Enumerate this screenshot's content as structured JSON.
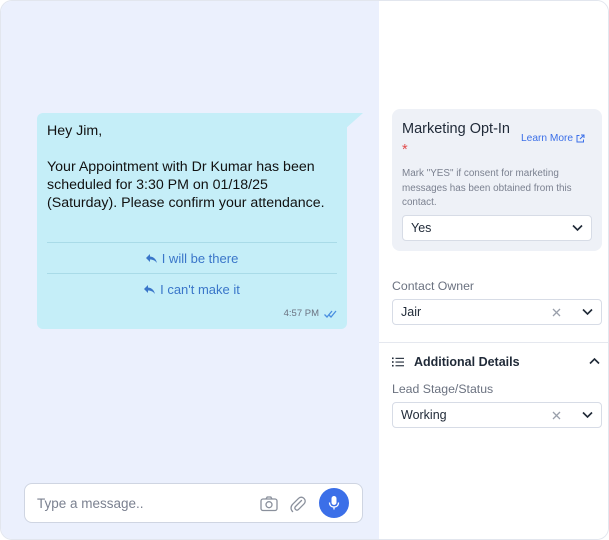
{
  "chat": {
    "message": {
      "text": "Hey Jim,\n\nYour Appointment with Dr Kumar has been scheduled for 3:30 PM on 01/18/25 (Saturday). Please confirm your attendance.",
      "quick_replies": [
        "I will be there",
        "I can't make it"
      ],
      "time": "4:57 PM"
    },
    "composer": {
      "placeholder": "Type a message.."
    }
  },
  "sidebar": {
    "marketing_optin": {
      "title": "Marketing Opt-In",
      "required_mark": "*",
      "learn_more": "Learn More",
      "description": "Mark \"YES\" if consent for marketing messages has been obtained from this contact.",
      "value": "Yes"
    },
    "contact_owner": {
      "label": "Contact Owner",
      "value": "Jair"
    },
    "additional_details": {
      "title": "Additional Details"
    },
    "lead_stage": {
      "label": "Lead Stage/Status",
      "value": "Working"
    }
  },
  "colors": {
    "chat_bg": "#ebf0fd",
    "bubble": "#c5eef8",
    "accent": "#3b6fe8",
    "required": "#e24b4b"
  }
}
